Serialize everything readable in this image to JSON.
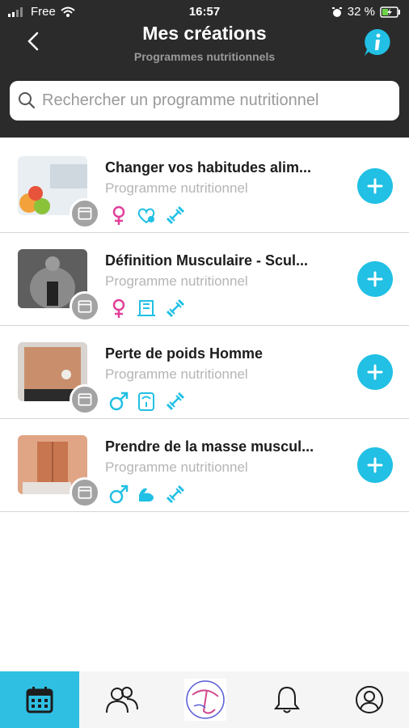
{
  "status": {
    "carrier": "Free",
    "time": "16:57",
    "battery": "32 %"
  },
  "header": {
    "title": "Mes créations",
    "subtitle": "Programmes nutritionnels"
  },
  "search": {
    "placeholder": "Rechercher un programme nutritionnel"
  },
  "programs": [
    {
      "title": "Changer vos habitudes alim...",
      "subtitle": "Programme nutritionnel",
      "gender": "female",
      "tags": [
        "female-icon",
        "heart-icon",
        "dumbbell-icon"
      ]
    },
    {
      "title": "Définition Musculaire - Scul...",
      "subtitle": "Programme nutritionnel",
      "gender": "female",
      "tags": [
        "female-icon",
        "body-icon",
        "dumbbell-icon"
      ]
    },
    {
      "title": "Perte de poids Homme",
      "subtitle": "Programme nutritionnel",
      "gender": "male",
      "tags": [
        "male-icon",
        "scale-icon",
        "dumbbell-icon"
      ]
    },
    {
      "title": "Prendre de la masse muscul...",
      "subtitle": "Programme nutritionnel",
      "gender": "male",
      "tags": [
        "male-icon",
        "biceps-icon",
        "dumbbell-icon"
      ]
    }
  ],
  "colors": {
    "accent": "#21c0e4",
    "female": "#e0409a",
    "header": "#2b2b2b",
    "active_tab": "#2fbfe3"
  },
  "tabs": [
    "calendar-icon",
    "community-icon",
    "logo",
    "bell-icon",
    "profile-icon"
  ]
}
